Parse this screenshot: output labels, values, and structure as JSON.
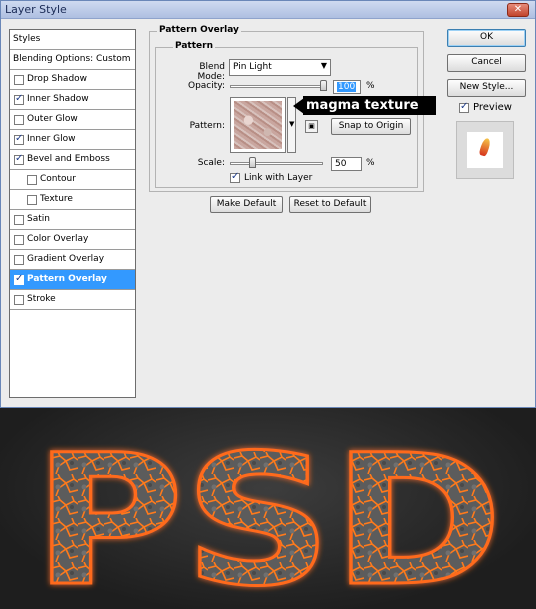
{
  "window": {
    "title": "Layer Style",
    "close_glyph": "✕"
  },
  "styles_panel": {
    "header": "Styles",
    "blending_options": "Blending Options: Custom",
    "items": [
      {
        "label": "Drop Shadow",
        "checked": false
      },
      {
        "label": "Inner Shadow",
        "checked": true
      },
      {
        "label": "Outer Glow",
        "checked": false
      },
      {
        "label": "Inner Glow",
        "checked": true
      },
      {
        "label": "Bevel and Emboss",
        "checked": true
      },
      {
        "label": "Contour",
        "checked": false
      },
      {
        "label": "Texture",
        "checked": false
      },
      {
        "label": "Satin",
        "checked": false
      },
      {
        "label": "Color Overlay",
        "checked": false
      },
      {
        "label": "Gradient Overlay",
        "checked": false
      },
      {
        "label": "Pattern Overlay",
        "checked": true
      },
      {
        "label": "Stroke",
        "checked": false
      }
    ]
  },
  "pattern_overlay": {
    "group_title": "Pattern Overlay",
    "subgroup_title": "Pattern",
    "blend_mode_label": "Blend Mode:",
    "blend_mode_value": "Pin Light",
    "opacity_label": "Opacity:",
    "opacity_value": "100",
    "opacity_level": 1.0,
    "percent": "%",
    "pattern_label": "Pattern:",
    "snap_to_origin": "Snap to Origin",
    "scale_label": "Scale:",
    "scale_value": "50",
    "scale_level": 0.22,
    "link_with_layer": "Link with Layer",
    "make_default": "Make Default",
    "reset_to_default": "Reset to Default"
  },
  "callout": {
    "text": "magma texture"
  },
  "actions": {
    "ok": "OK",
    "cancel": "Cancel",
    "new_style": "New Style...",
    "preview": "Preview"
  },
  "artwork": {
    "text": "PSD"
  },
  "colors": {
    "selection": "#3399ff",
    "lava": "#ff6a1a",
    "rock": "#5a5a5a"
  }
}
